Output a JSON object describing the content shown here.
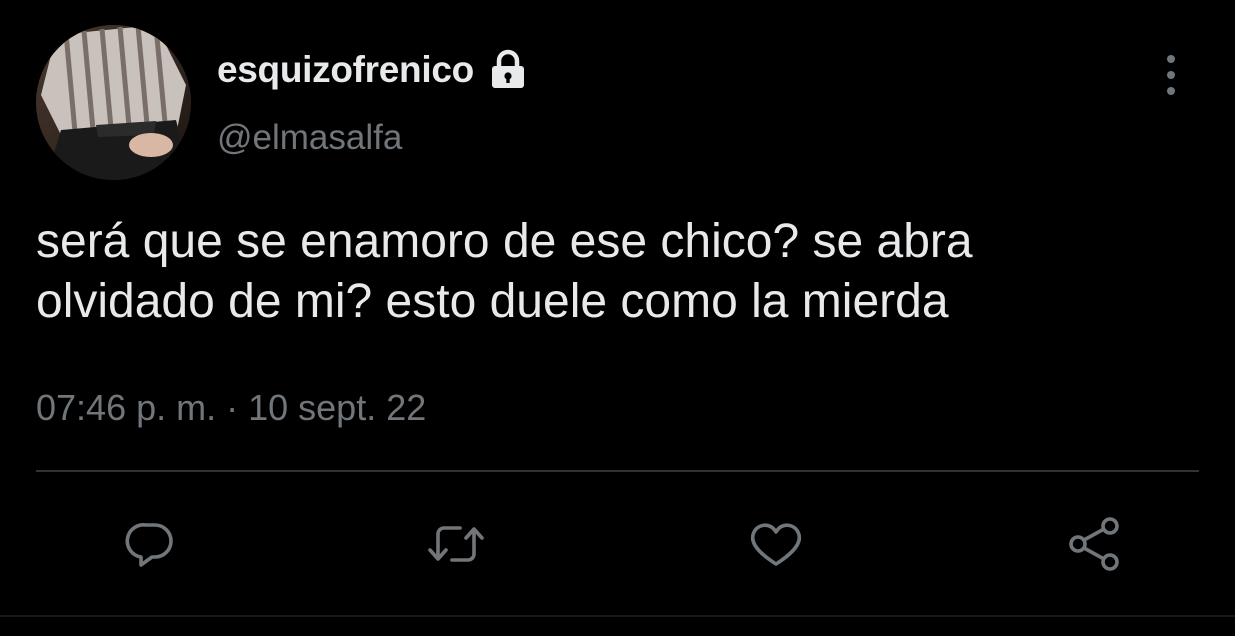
{
  "author": {
    "display_name": "esquizofrenico",
    "handle": "@elmasalfa",
    "protected": true,
    "avatar_icon": "avatar-photo"
  },
  "tweet": {
    "text": "será que se enamoro de ese chico? se abra\nolvidado de mi? esto duele como la mierda",
    "time": "07:46 p. m.",
    "separator": "·",
    "date": "10 sept. 22"
  },
  "actions": [
    {
      "name": "reply",
      "icon": "reply-icon"
    },
    {
      "name": "retweet",
      "icon": "retweet-icon"
    },
    {
      "name": "like",
      "icon": "heart-icon"
    },
    {
      "name": "share",
      "icon": "share-icon"
    }
  ],
  "colors": {
    "background": "#000000",
    "primary_text": "#e7e9ea",
    "secondary_text": "#71767b",
    "divider": "#2f3336"
  }
}
